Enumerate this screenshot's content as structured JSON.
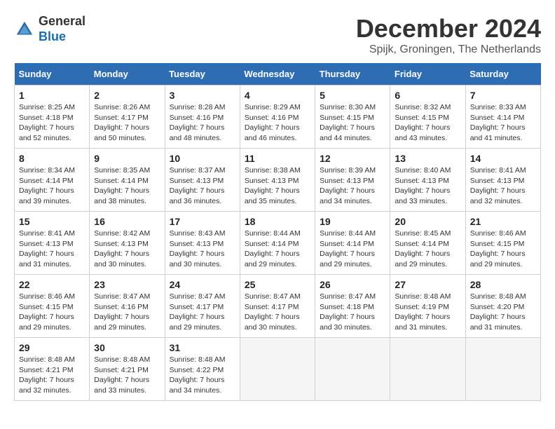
{
  "header": {
    "logo_line1": "General",
    "logo_line2": "Blue",
    "month_title": "December 2024",
    "location": "Spijk, Groningen, The Netherlands"
  },
  "days_of_week": [
    "Sunday",
    "Monday",
    "Tuesday",
    "Wednesday",
    "Thursday",
    "Friday",
    "Saturday"
  ],
  "weeks": [
    [
      {
        "day": "1",
        "info": "Sunrise: 8:25 AM\nSunset: 4:18 PM\nDaylight: 7 hours\nand 52 minutes."
      },
      {
        "day": "2",
        "info": "Sunrise: 8:26 AM\nSunset: 4:17 PM\nDaylight: 7 hours\nand 50 minutes."
      },
      {
        "day": "3",
        "info": "Sunrise: 8:28 AM\nSunset: 4:16 PM\nDaylight: 7 hours\nand 48 minutes."
      },
      {
        "day": "4",
        "info": "Sunrise: 8:29 AM\nSunset: 4:16 PM\nDaylight: 7 hours\nand 46 minutes."
      },
      {
        "day": "5",
        "info": "Sunrise: 8:30 AM\nSunset: 4:15 PM\nDaylight: 7 hours\nand 44 minutes."
      },
      {
        "day": "6",
        "info": "Sunrise: 8:32 AM\nSunset: 4:15 PM\nDaylight: 7 hours\nand 43 minutes."
      },
      {
        "day": "7",
        "info": "Sunrise: 8:33 AM\nSunset: 4:14 PM\nDaylight: 7 hours\nand 41 minutes."
      }
    ],
    [
      {
        "day": "8",
        "info": "Sunrise: 8:34 AM\nSunset: 4:14 PM\nDaylight: 7 hours\nand 39 minutes."
      },
      {
        "day": "9",
        "info": "Sunrise: 8:35 AM\nSunset: 4:14 PM\nDaylight: 7 hours\nand 38 minutes."
      },
      {
        "day": "10",
        "info": "Sunrise: 8:37 AM\nSunset: 4:13 PM\nDaylight: 7 hours\nand 36 minutes."
      },
      {
        "day": "11",
        "info": "Sunrise: 8:38 AM\nSunset: 4:13 PM\nDaylight: 7 hours\nand 35 minutes."
      },
      {
        "day": "12",
        "info": "Sunrise: 8:39 AM\nSunset: 4:13 PM\nDaylight: 7 hours\nand 34 minutes."
      },
      {
        "day": "13",
        "info": "Sunrise: 8:40 AM\nSunset: 4:13 PM\nDaylight: 7 hours\nand 33 minutes."
      },
      {
        "day": "14",
        "info": "Sunrise: 8:41 AM\nSunset: 4:13 PM\nDaylight: 7 hours\nand 32 minutes."
      }
    ],
    [
      {
        "day": "15",
        "info": "Sunrise: 8:41 AM\nSunset: 4:13 PM\nDaylight: 7 hours\nand 31 minutes."
      },
      {
        "day": "16",
        "info": "Sunrise: 8:42 AM\nSunset: 4:13 PM\nDaylight: 7 hours\nand 30 minutes."
      },
      {
        "day": "17",
        "info": "Sunrise: 8:43 AM\nSunset: 4:13 PM\nDaylight: 7 hours\nand 30 minutes."
      },
      {
        "day": "18",
        "info": "Sunrise: 8:44 AM\nSunset: 4:14 PM\nDaylight: 7 hours\nand 29 minutes."
      },
      {
        "day": "19",
        "info": "Sunrise: 8:44 AM\nSunset: 4:14 PM\nDaylight: 7 hours\nand 29 minutes."
      },
      {
        "day": "20",
        "info": "Sunrise: 8:45 AM\nSunset: 4:14 PM\nDaylight: 7 hours\nand 29 minutes."
      },
      {
        "day": "21",
        "info": "Sunrise: 8:46 AM\nSunset: 4:15 PM\nDaylight: 7 hours\nand 29 minutes."
      }
    ],
    [
      {
        "day": "22",
        "info": "Sunrise: 8:46 AM\nSunset: 4:15 PM\nDaylight: 7 hours\nand 29 minutes."
      },
      {
        "day": "23",
        "info": "Sunrise: 8:47 AM\nSunset: 4:16 PM\nDaylight: 7 hours\nand 29 minutes."
      },
      {
        "day": "24",
        "info": "Sunrise: 8:47 AM\nSunset: 4:17 PM\nDaylight: 7 hours\nand 29 minutes."
      },
      {
        "day": "25",
        "info": "Sunrise: 8:47 AM\nSunset: 4:17 PM\nDaylight: 7 hours\nand 30 minutes."
      },
      {
        "day": "26",
        "info": "Sunrise: 8:47 AM\nSunset: 4:18 PM\nDaylight: 7 hours\nand 30 minutes."
      },
      {
        "day": "27",
        "info": "Sunrise: 8:48 AM\nSunset: 4:19 PM\nDaylight: 7 hours\nand 31 minutes."
      },
      {
        "day": "28",
        "info": "Sunrise: 8:48 AM\nSunset: 4:20 PM\nDaylight: 7 hours\nand 31 minutes."
      }
    ],
    [
      {
        "day": "29",
        "info": "Sunrise: 8:48 AM\nSunset: 4:21 PM\nDaylight: 7 hours\nand 32 minutes."
      },
      {
        "day": "30",
        "info": "Sunrise: 8:48 AM\nSunset: 4:21 PM\nDaylight: 7 hours\nand 33 minutes."
      },
      {
        "day": "31",
        "info": "Sunrise: 8:48 AM\nSunset: 4:22 PM\nDaylight: 7 hours\nand 34 minutes."
      },
      {
        "day": "",
        "info": ""
      },
      {
        "day": "",
        "info": ""
      },
      {
        "day": "",
        "info": ""
      },
      {
        "day": "",
        "info": ""
      }
    ]
  ]
}
